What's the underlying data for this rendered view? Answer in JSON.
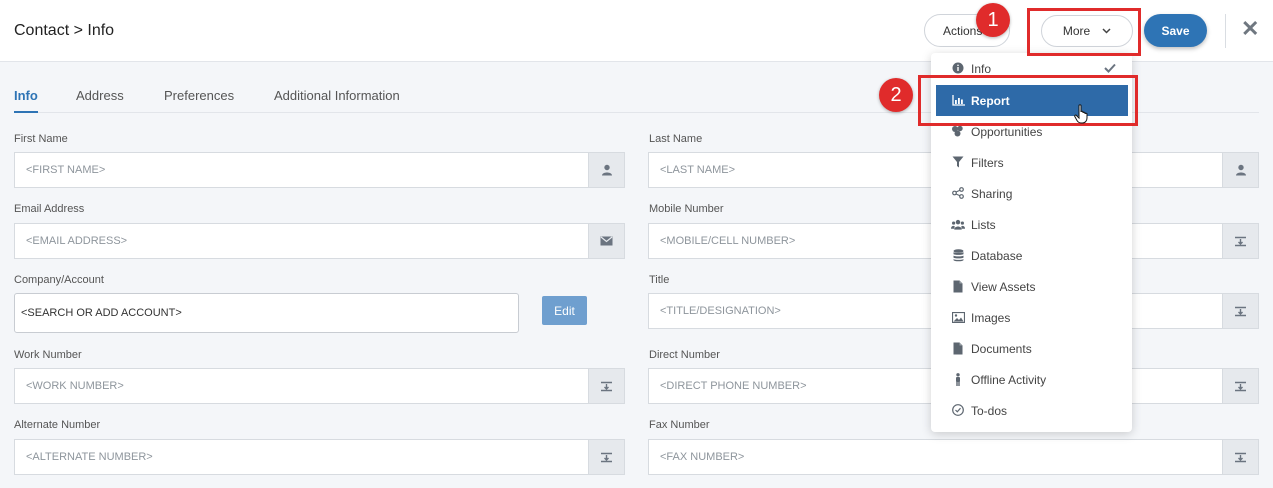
{
  "header": {
    "title": "Contact > Info",
    "actions_label": "Actions",
    "more_label": "More",
    "save_label": "Save"
  },
  "tabs": [
    {
      "label": "Info",
      "active": true
    },
    {
      "label": "Address",
      "active": false
    },
    {
      "label": "Preferences",
      "active": false
    },
    {
      "label": "Additional Information",
      "active": false
    }
  ],
  "form": {
    "first_name": {
      "label": "First Name",
      "placeholder": "<FIRST NAME>"
    },
    "last_name": {
      "label": "Last Name",
      "placeholder": "<LAST NAME>"
    },
    "email": {
      "label": "Email Address",
      "placeholder": "<EMAIL ADDRESS>"
    },
    "mobile": {
      "label": "Mobile Number",
      "placeholder": "<MOBILE/CELL NUMBER>"
    },
    "company": {
      "label": "Company/Account",
      "placeholder": "<SEARCH OR ADD ACCOUNT>",
      "edit_label": "Edit"
    },
    "title": {
      "label": "Title",
      "placeholder": "<TITLE/DESIGNATION>"
    },
    "work": {
      "label": "Work Number",
      "placeholder": "<WORK NUMBER>"
    },
    "direct": {
      "label": "Direct Number",
      "placeholder": "<DIRECT PHONE NUMBER>"
    },
    "alternate": {
      "label": "Alternate Number",
      "placeholder": "<ALTERNATE NUMBER>"
    },
    "fax": {
      "label": "Fax Number",
      "placeholder": "<FAX NUMBER>"
    }
  },
  "more_menu": {
    "items": [
      {
        "label": "Info",
        "icon": "info-icon",
        "checked": true
      },
      {
        "label": "Report",
        "icon": "bar-chart-icon",
        "selected": true
      },
      {
        "label": "Opportunities",
        "icon": "opportunities-icon"
      },
      {
        "label": "Filters",
        "icon": "filter-icon"
      },
      {
        "label": "Sharing",
        "icon": "share-icon"
      },
      {
        "label": "Lists",
        "icon": "users-icon"
      },
      {
        "label": "Database",
        "icon": "database-icon"
      },
      {
        "label": "View Assets",
        "icon": "file-icon"
      },
      {
        "label": "Images",
        "icon": "image-icon"
      },
      {
        "label": "Documents",
        "icon": "document-icon"
      },
      {
        "label": "Offline Activity",
        "icon": "person-icon"
      },
      {
        "label": "To-dos",
        "icon": "check-circle-icon"
      }
    ]
  },
  "annotations": {
    "step1": "1",
    "step2": "2",
    "highlight_color": "#e02b2b"
  },
  "colors": {
    "primary": "#2e74b5",
    "menu_selected": "#2e6aa8",
    "edit_button": "#6f9fcf"
  }
}
